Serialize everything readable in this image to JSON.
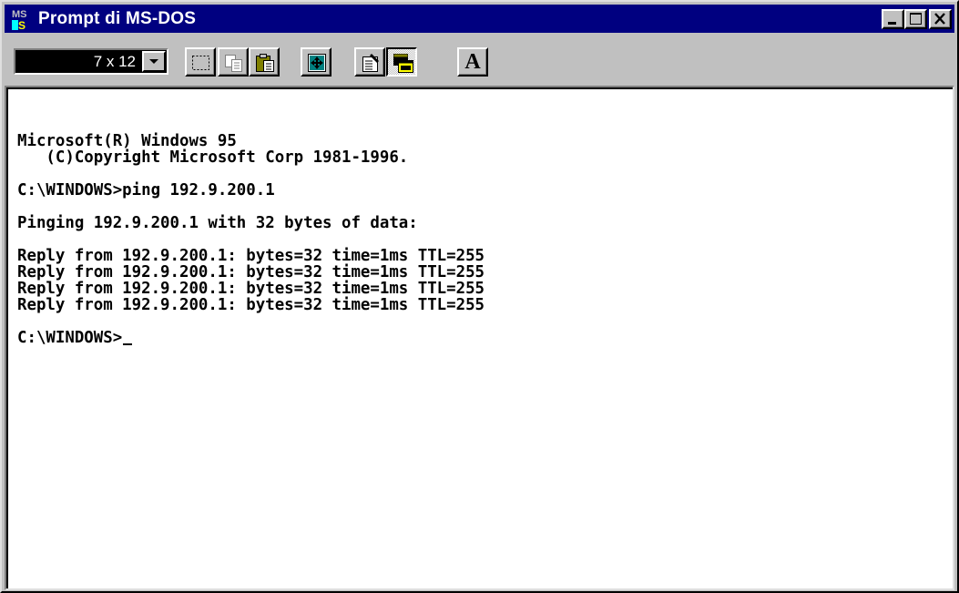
{
  "window": {
    "title": "Prompt di MS-DOS",
    "app_icon": "ms-dos-icon",
    "controls": [
      "minimize-icon",
      "maximize-icon",
      "close-icon"
    ],
    "title_bar_color": "#000080"
  },
  "toolbar": {
    "font_size_value": "7 x 12",
    "buttons": [
      {
        "name": "mark-button",
        "icon": "mark-icon"
      },
      {
        "name": "copy-button",
        "icon": "copy-icon"
      },
      {
        "name": "paste-button",
        "icon": "paste-icon"
      },
      {
        "name": "full-screen-button",
        "icon": "full-screen-icon"
      },
      {
        "name": "properties-button",
        "icon": "properties-icon"
      },
      {
        "name": "background-button",
        "icon": "background-icon",
        "pressed": true
      },
      {
        "name": "font-button",
        "label": "A"
      }
    ],
    "font_button_label": "A"
  },
  "console": {
    "background": "#ffffff",
    "text_color": "#000000",
    "lines": [
      "Microsoft(R) Windows 95",
      "   (C)Copyright Microsoft Corp 1981-1996.",
      "",
      "C:\\WINDOWS>ping 192.9.200.1",
      "",
      "Pinging 192.9.200.1 with 32 bytes of data:",
      "",
      "Reply from 192.9.200.1: bytes=32 time=1ms TTL=255",
      "Reply from 192.9.200.1: bytes=32 time=1ms TTL=255",
      "Reply from 192.9.200.1: bytes=32 time=1ms TTL=255",
      "Reply from 192.9.200.1: bytes=32 time=1ms TTL=255",
      "",
      "C:\\WINDOWS>"
    ]
  }
}
